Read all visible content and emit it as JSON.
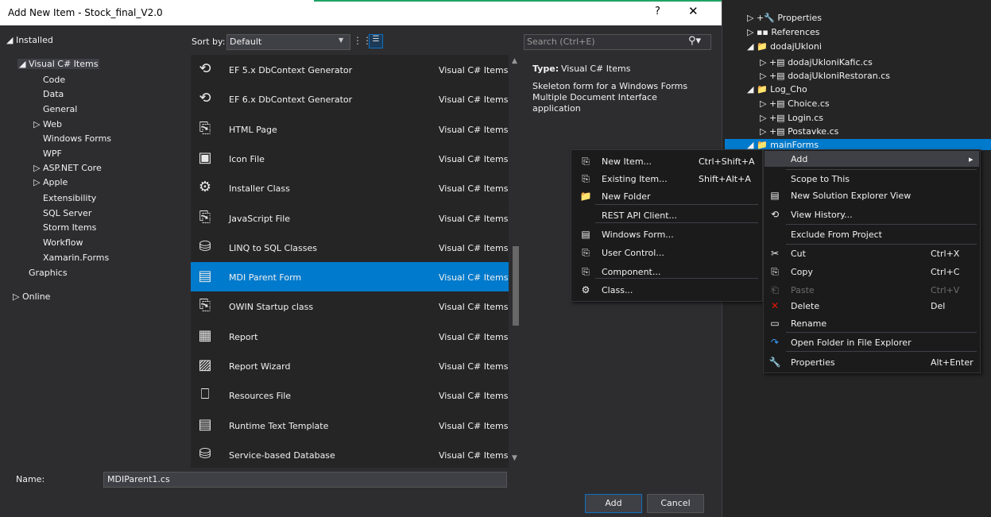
{
  "dialog": {
    "title": "Add New Item - Stock_final_V2.0",
    "help": "?",
    "close": "✕",
    "installed": "◢  Installed",
    "tree": [
      {
        "label": "◢ Visual C# Items"
      },
      {
        "label": "Code"
      },
      {
        "label": "Data"
      },
      {
        "label": "General"
      },
      {
        "label": "▷ Web"
      },
      {
        "label": "Windows Forms"
      },
      {
        "label": "WPF"
      },
      {
        "label": "▷ ASP.NET Core"
      },
      {
        "label": "▷ Apple"
      },
      {
        "label": "Extensibility"
      },
      {
        "label": "SQL Server"
      },
      {
        "label": "Storm Items"
      },
      {
        "label": "Workflow"
      },
      {
        "label": "Xamarin.Forms"
      },
      {
        "label": "Graphics"
      },
      {
        "label": "▷ Online"
      }
    ],
    "sort_label": "Sort by:",
    "sort_value": "Default",
    "sort_arrow": "▼",
    "grid_view": "⋮⋮",
    "list_view": "☰",
    "items": [
      {
        "name": "EF 5.x DbContext Generator",
        "type": "Visual C# Items",
        "icon": "⟲"
      },
      {
        "name": "EF 6.x DbContext Generator",
        "type": "Visual C# Items",
        "icon": "⟲"
      },
      {
        "name": "HTML Page",
        "type": "Visual C# Items",
        "icon": "⎘"
      },
      {
        "name": "Icon File",
        "type": "Visual C# Items",
        "icon": "▣"
      },
      {
        "name": "Installer Class",
        "type": "Visual C# Items",
        "icon": "⚙"
      },
      {
        "name": "JavaScript File",
        "type": "Visual C# Items",
        "icon": "⎘"
      },
      {
        "name": "LINQ to SQL Classes",
        "type": "Visual C# Items",
        "icon": "⛁"
      },
      {
        "name": "MDI Parent Form",
        "type": "Visual C# Items",
        "icon": "▤"
      },
      {
        "name": "OWIN Startup class",
        "type": "Visual C# Items",
        "icon": "⎘"
      },
      {
        "name": "Report",
        "type": "Visual C# Items",
        "icon": "▦"
      },
      {
        "name": "Report Wizard",
        "type": "Visual C# Items",
        "icon": "▨"
      },
      {
        "name": "Resources File",
        "type": "Visual C# Items",
        "icon": "⎕"
      },
      {
        "name": "Runtime Text Template",
        "type": "Visual C# Items",
        "icon": "▤"
      },
      {
        "name": "Service-based Database",
        "type": "Visual C# Items",
        "icon": "⛁"
      }
    ],
    "search_placeholder": "Search (Ctrl+E)",
    "search_icon": "⚲▾",
    "type_label": "Type:",
    "type_value": "Visual C# Items",
    "description": "Skeleton form for a Windows Forms Multiple Document Interface application",
    "name_label": "Name:",
    "name_value": "MDIParent1.cs",
    "add_label": "Add",
    "cancel_label": "Cancel"
  },
  "solution_explorer": {
    "items": [
      {
        "label": "▷ +🔧 Properties"
      },
      {
        "label": "▷ ▪▪ References"
      },
      {
        "label": "◢ 📁 dodajUkloni"
      },
      {
        "label": "▷ +▤ dodajUkloniKafic.cs"
      },
      {
        "label": "▷ +▤ dodajUkloniRestoran.cs"
      },
      {
        "label": "◢ 📁 Log_Cho"
      },
      {
        "label": "▷ +▤ Choice.cs"
      },
      {
        "label": "▷ +▤ Login.cs"
      },
      {
        "label": "▷ +▤ Postavke.cs"
      },
      {
        "label": "◢ 📁 mainForms"
      }
    ]
  },
  "add_submenu": {
    "items": [
      {
        "label": "New Item...",
        "shortcut": "Ctrl+Shift+A",
        "icon": "⎘"
      },
      {
        "label": "Existing Item...",
        "shortcut": "Shift+Alt+A",
        "icon": "⎘"
      },
      {
        "label": "New Folder",
        "shortcut": "",
        "icon": "📁"
      },
      {
        "label": "REST API Client...",
        "shortcut": "",
        "icon": ""
      },
      {
        "label": "Windows Form...",
        "shortcut": "",
        "icon": "▤"
      },
      {
        "label": "User Control...",
        "shortcut": "",
        "icon": "⎘"
      },
      {
        "label": "Component...",
        "shortcut": "",
        "icon": "⎘"
      },
      {
        "label": "Class...",
        "shortcut": "",
        "icon": "⚙"
      }
    ]
  },
  "context_menu": {
    "items": [
      {
        "label": "Add",
        "shortcut": "▸",
        "icon": ""
      },
      {
        "label": "Scope to This",
        "shortcut": "",
        "icon": ""
      },
      {
        "label": "New Solution Explorer View",
        "shortcut": "",
        "icon": "▤"
      },
      {
        "label": "View History...",
        "shortcut": "",
        "icon": "⟲"
      },
      {
        "label": "Exclude From Project",
        "shortcut": "",
        "icon": ""
      },
      {
        "label": "Cut",
        "shortcut": "Ctrl+X",
        "icon": "✂"
      },
      {
        "label": "Copy",
        "shortcut": "Ctrl+C",
        "icon": "⎘"
      },
      {
        "label": "Paste",
        "shortcut": "Ctrl+V",
        "icon": "⎗"
      },
      {
        "label": "Delete",
        "shortcut": "Del",
        "icon": "✕"
      },
      {
        "label": "Rename",
        "shortcut": "",
        "icon": "▭"
      },
      {
        "label": "Open Folder in File Explorer",
        "shortcut": "",
        "icon": "↷"
      },
      {
        "label": "Properties",
        "shortcut": "Alt+Enter",
        "icon": "🔧"
      }
    ]
  },
  "colors": {
    "accent": "#007acc",
    "delete": "#e51400"
  }
}
